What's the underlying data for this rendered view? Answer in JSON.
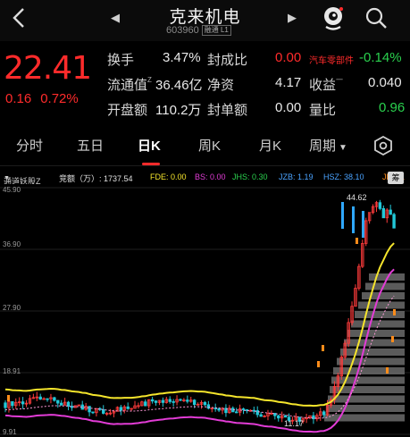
{
  "header": {
    "title": "克来机电",
    "code": "603960",
    "badge": "融通 L1",
    "prev_glyph": "◀",
    "next_glyph": "▶",
    "back_icon": "chevron-left-icon",
    "mascot_icon": "mascot-icon",
    "search_icon": "search-icon"
  },
  "quote": {
    "price": "22.41",
    "change": "0.16",
    "change_pct": "0.72%",
    "turnover_label": "换手",
    "turnover": "3.47%",
    "seal_ratio_label": "封成比",
    "seal_ratio": "0.00",
    "sector": "汽车零部件",
    "sector_change": "-0.14%",
    "float_cap_label": "流通值",
    "float_cap_sup": "Z",
    "float_cap": "36.46亿",
    "net_asset_label": "净资",
    "net_asset": "4.17",
    "eps_label": "收益",
    "eps_sup": "一",
    "eps": "0.040",
    "open_amount_label": "开盘额",
    "open_amount": "110.2万",
    "seal_amount_label": "封单额",
    "seal_amount": "0.00",
    "volume_ratio_label": "量比",
    "volume_ratio": "0.96"
  },
  "tabs": [
    {
      "label": "分时"
    },
    {
      "label": "五日"
    },
    {
      "label": "日K"
    },
    {
      "label": "周K"
    },
    {
      "label": "月K"
    },
    {
      "label": "周期"
    }
  ],
  "tab_dropdown": "▼",
  "indicators": {
    "name": "通道妖股Z",
    "name_suffix": "▼",
    "bid_label": "竞额（万）: 1737.54",
    "fde": "FDE: 0.00",
    "bs": "BS: 0.00",
    "jhs": "JHS: 0.30",
    "jzb": "JZB: 1.19",
    "hsz": "HSZ: 38.10",
    "jf": "JF: 91",
    "btn": "筹"
  },
  "chart_data": {
    "type": "candlestick",
    "y_ticks": [
      "45.90",
      "36.90",
      "27.90",
      "18.91",
      "9.91"
    ],
    "ylim": [
      9.91,
      45.9
    ],
    "high_annotation": "44.62",
    "low_annotation": "11.17",
    "colors": {
      "up": "#ff3b3b",
      "down": "#22c8d8",
      "yellow_line": "#f5e52c",
      "magenta_line": "#e23cd6",
      "band": "#6b6b6b",
      "orange": "#ff8c1a"
    }
  }
}
